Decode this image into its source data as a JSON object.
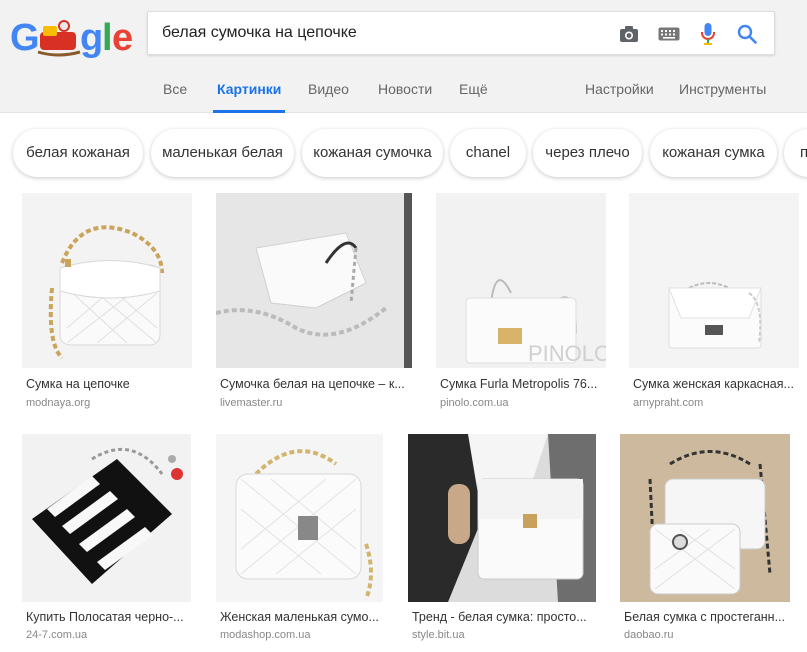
{
  "logo": {
    "alt": "Google"
  },
  "search": {
    "query": "белая сумочка на цепочке"
  },
  "icons": {
    "camera": "camera-icon",
    "keyboard": "keyboard-icon",
    "mic": "microphone-icon",
    "search": "search-icon"
  },
  "colors": {
    "accent": "#1a73e8",
    "background": "#f2f2f2"
  },
  "tabs": [
    {
      "label": "Все"
    },
    {
      "label": "Картинки",
      "active": true
    },
    {
      "label": "Видео"
    },
    {
      "label": "Новости"
    },
    {
      "label": "Ещё"
    },
    {
      "label": "Настройки"
    },
    {
      "label": "Инструменты"
    }
  ],
  "chips": [
    {
      "label": "белая кожаная"
    },
    {
      "label": "маленькая белая"
    },
    {
      "label": "кожаная сумочка"
    },
    {
      "label": "chanel"
    },
    {
      "label": "через плечо"
    },
    {
      "label": "кожаная сумка"
    },
    {
      "label": "п"
    }
  ],
  "results": [
    {
      "caption": "Сумка на цепочке",
      "source": "modnaya.org"
    },
    {
      "caption": "Сумочка белая на цепочке – к...",
      "source": "livemaster.ru"
    },
    {
      "caption": "Сумка Furla Metropolis 76...",
      "source": "pinolo.com.ua",
      "watermark": "PINOLO"
    },
    {
      "caption": "Сумка женская каркасная...",
      "source": "arnypraht.com"
    },
    {
      "caption": "Купить Полосатая черно-...",
      "source": "24-7.com.ua"
    },
    {
      "caption": "Женская маленькая сумо...",
      "source": "modashop.com.ua"
    },
    {
      "caption": "Тренд - белая сумка: просто...",
      "source": "style.bit.ua"
    },
    {
      "caption": "Белая сумка с простеганн...",
      "source": "daobao.ru"
    }
  ]
}
